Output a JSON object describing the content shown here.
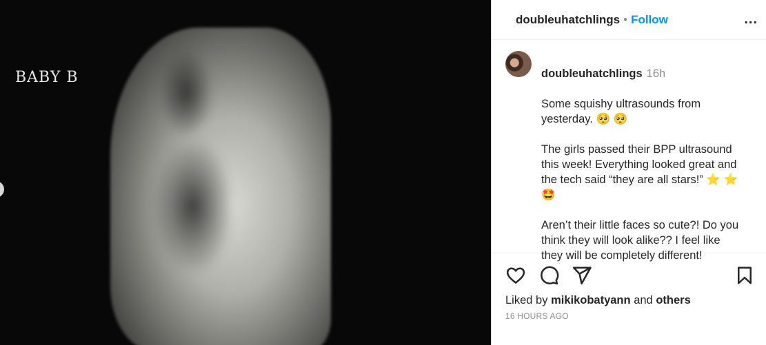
{
  "image": {
    "label": "BABY B"
  },
  "header": {
    "username": "doubleuhatchlings",
    "separator": "•",
    "follow_label": "Follow",
    "more_label": "..."
  },
  "caption": {
    "username": "doubleuhatchlings",
    "time": "16h",
    "paragraphs": [
      "Some squishy ultrasounds from\nyesterday. 🥺 🥺",
      "The girls passed their BPP ultrasound\nthis week! Everything looked great and\nthe tech said “they are all stars!” ⭐ ⭐\n🤩",
      "Aren’t their little faces so cute?! Do you\nthink they will look alike?? I feel like\nthey will be completely different!"
    ]
  },
  "actions": {
    "like_icon": "heart-icon",
    "comment_icon": "comment-icon",
    "share_icon": "send-icon",
    "save_icon": "bookmark-icon"
  },
  "likes": {
    "prefix": "Liked by",
    "user": "mikikobatyann",
    "conjunction": "and",
    "others": "others"
  },
  "timestamp": "16 HOURS AGO"
}
